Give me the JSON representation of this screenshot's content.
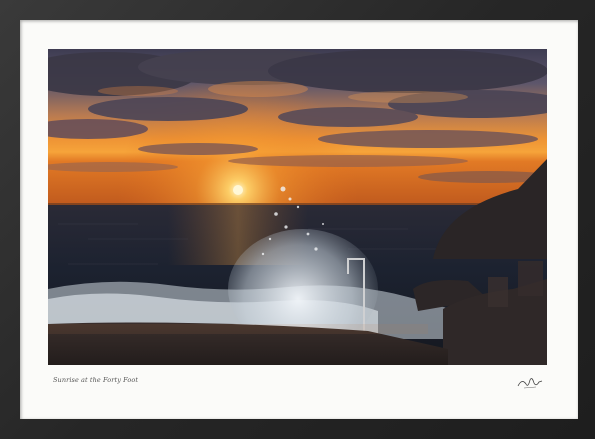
{
  "print": {
    "caption": "Sunrise at the Forty Foot",
    "signature": "artist-signature"
  },
  "photo": {
    "subject": "sunrise-over-sea-wave-splash",
    "colors": {
      "sun": "#fff6c8",
      "sky_glow": "#f08a2a",
      "sky_high": "#54506a",
      "sea": "#1c2430",
      "foam": "#dfe8f0",
      "rock": "#2a2526"
    }
  },
  "frame": {
    "color": "#2b2b2b",
    "mat_color": "#fbfbf9"
  }
}
